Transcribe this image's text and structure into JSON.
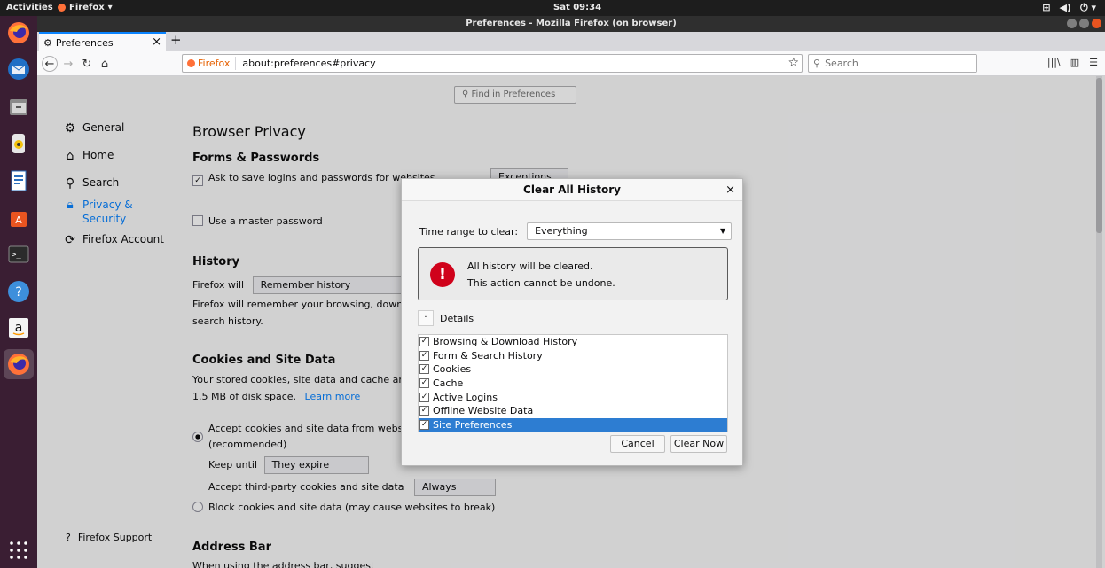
{
  "topbar": {
    "activities": "Activities",
    "app": "Firefox",
    "clock": "Sat 09:34"
  },
  "window": {
    "title": "Preferences - Mozilla Firefox (on browser)"
  },
  "tab": {
    "label": "Preferences"
  },
  "urlbar": {
    "identity": "Firefox",
    "url": "about:preferences#privacy"
  },
  "searchbar": {
    "placeholder": "Search"
  },
  "prefs": {
    "find_placeholder": "Find in Preferences",
    "categories": [
      "General",
      "Home",
      "Search",
      "Privacy & Security",
      "Firefox Account"
    ],
    "heading": "Browser Privacy",
    "forms_heading": "Forms & Passwords",
    "ask_logins": "Ask to save logins and passwords for websites",
    "exceptions": "Exceptions...",
    "master_password": "Use a master password",
    "history_heading": "History",
    "firefox_will": "Firefox will",
    "history_mode": "Remember history",
    "history_desc1": "Firefox will remember your browsing, downloa",
    "history_desc2": "search history.",
    "cookies_heading": "Cookies and Site Data",
    "cookies_desc1": "Your stored cookies, site data and cache are c",
    "cookies_desc2": "1.5 MB of disk space.",
    "learn_more": "Learn more",
    "accept_cookies": "Accept cookies and site data from website",
    "recommended": "(recommended)",
    "keep_until": "Keep until",
    "keep_until_value": "They expire",
    "third_party": "Accept third-party cookies and site data",
    "third_party_value": "Always",
    "block_cookies": "Block cookies and site data (may cause websites to break)",
    "address_heading": "Address Bar",
    "address_desc": "When using the address bar, suggest",
    "support": "Firefox Support"
  },
  "dialog": {
    "title": "Clear All History",
    "time_range_label": "Time range to clear:",
    "time_range_value": "Everything",
    "warning_line1": "All history will be cleared.",
    "warning_line2": "This action cannot be undone.",
    "details_label": "Details",
    "items": [
      {
        "label": "Browsing & Download History",
        "checked": true
      },
      {
        "label": "Form & Search History",
        "checked": true
      },
      {
        "label": "Cookies",
        "checked": true
      },
      {
        "label": "Cache",
        "checked": true
      },
      {
        "label": "Active Logins",
        "checked": true
      },
      {
        "label": "Offline Website Data",
        "checked": true
      },
      {
        "label": "Site Preferences",
        "checked": true,
        "selected": true
      }
    ],
    "cancel": "Cancel",
    "clear_now": "Clear Now"
  },
  "colors": {
    "accent": "#0a84ff",
    "warning": "#d0021b",
    "selection": "#2d7dd2"
  }
}
